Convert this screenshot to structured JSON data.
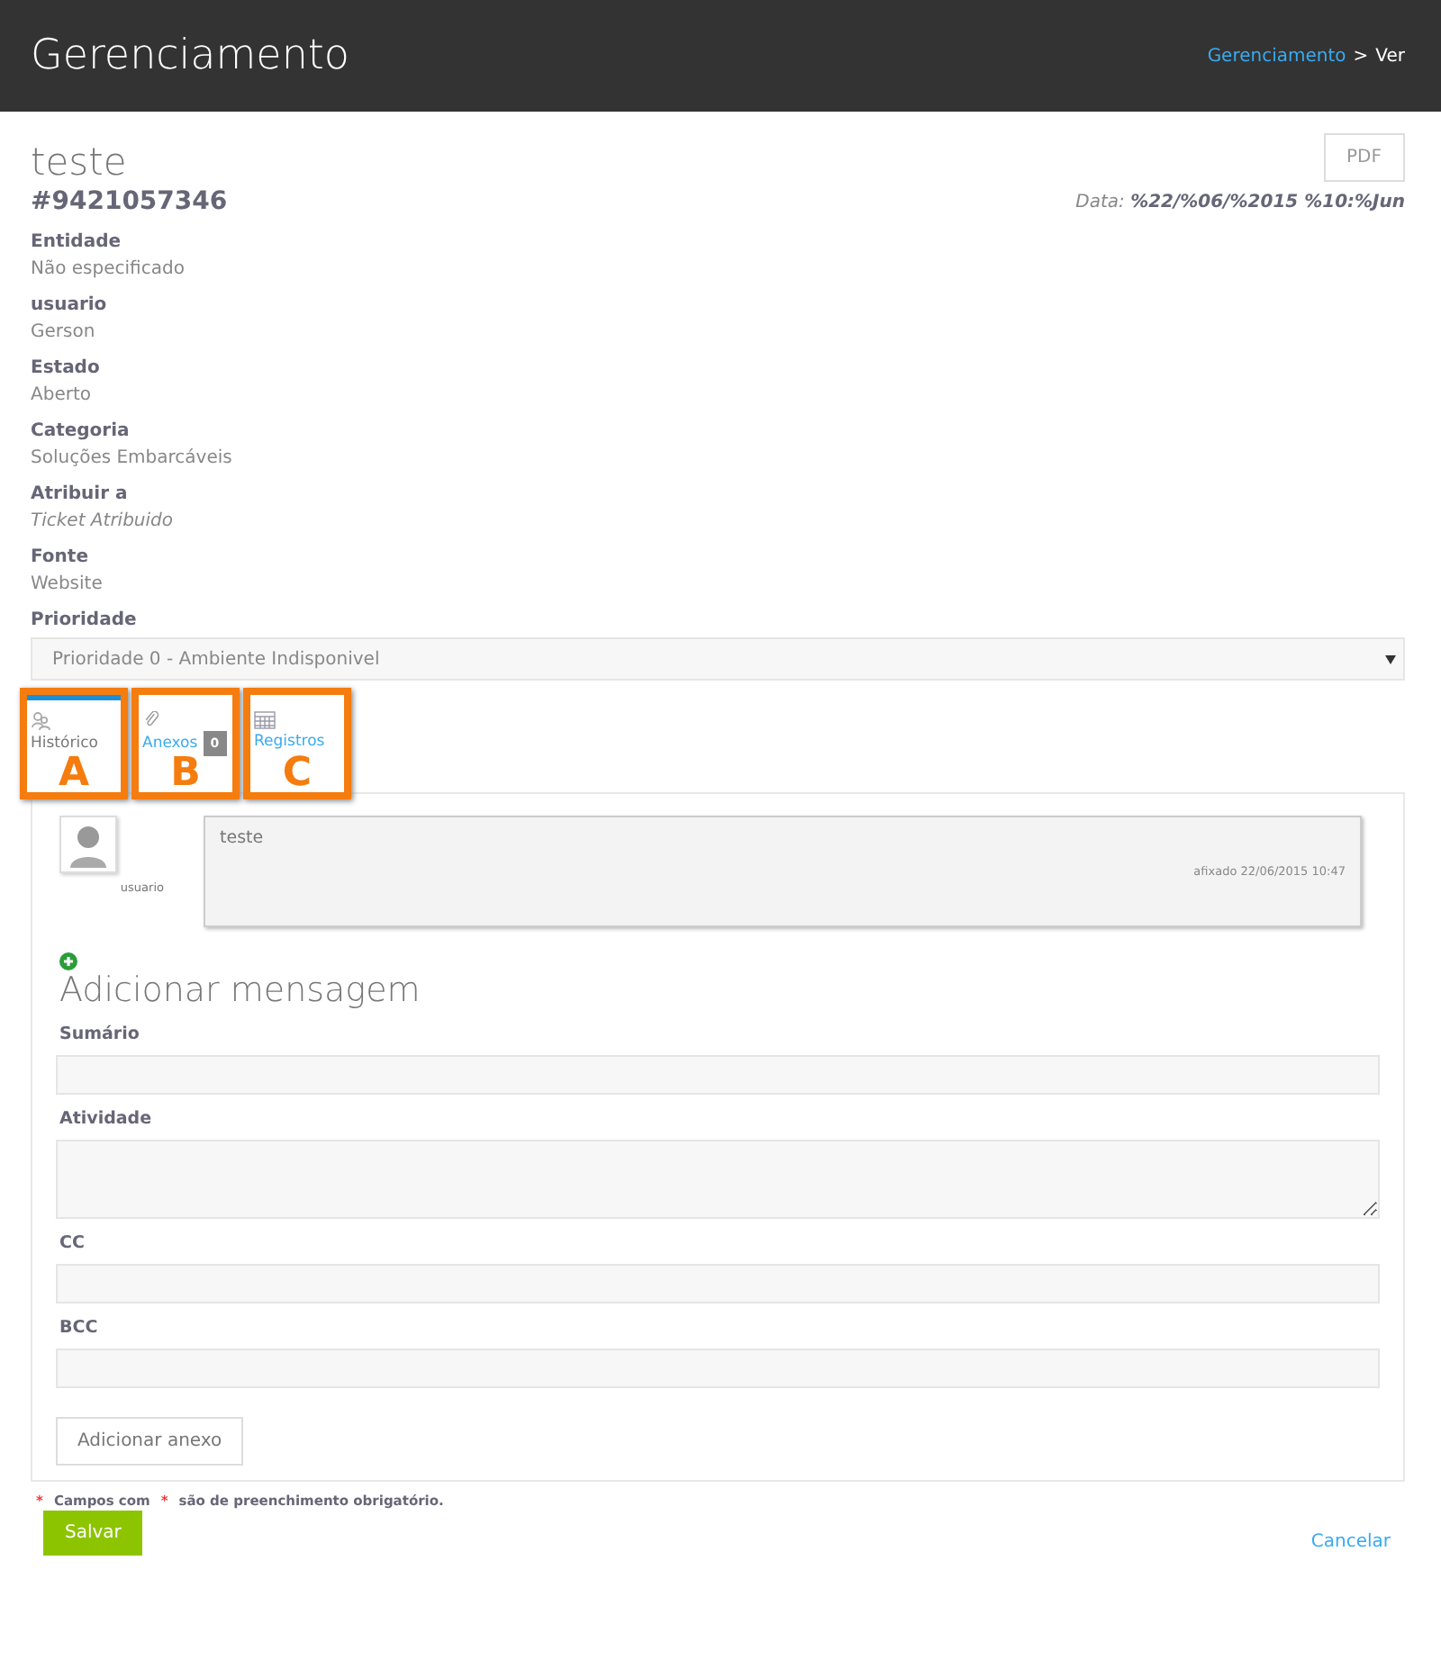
{
  "header": {
    "title": "Gerenciamento",
    "breadcrumb": [
      {
        "label": "Gerenciamento",
        "kind": "link"
      },
      {
        "label": "Ver",
        "kind": "current"
      }
    ],
    "separator": ">"
  },
  "ticket": {
    "title": "teste",
    "number": "#9421057346",
    "pdf_button": "PDF",
    "date": "Data: **%22/%06/%2015 %10:%Jun**"
  },
  "fields": [
    {
      "label": "Entidade",
      "value": "Não especificado",
      "italic": false
    },
    {
      "label": "usuario",
      "value": "Gerson",
      "italic": false
    },
    {
      "label": "Estado",
      "value": "Aberto",
      "italic": false
    },
    {
      "label": "Categoria",
      "value": "Soluções Embarcáveis",
      "italic": false
    },
    {
      "label": "Atribuir a",
      "value": "Ticket Atribuido",
      "italic": true
    },
    {
      "label": "Fonte",
      "value": "Website",
      "italic": false
    }
  ],
  "priority": {
    "label": "Prioridade",
    "value": "Prioridade 0 - Ambiente Indisponivel"
  },
  "tabs": [
    {
      "label": "Histórico",
      "kind": "history",
      "selected": true,
      "callout": "A"
    },
    {
      "label": "Anexos",
      "kind": "attachments",
      "selected": false,
      "badge": "0",
      "callout": "B"
    },
    {
      "label": "Registros",
      "kind": "logs",
      "selected": false,
      "callout": "C"
    }
  ],
  "messages": [
    {
      "user": "usuario",
      "text": "teste",
      "timestamp": "afixado 22/06/2015 10:47"
    }
  ],
  "form": {
    "title": "Adicionar mensagem",
    "fields": [
      {
        "label": "Sumário",
        "kind": "input"
      },
      {
        "label": "Atividade",
        "kind": "textarea"
      },
      {
        "label": "CC",
        "kind": "input"
      },
      {
        "label": "BCC",
        "kind": "input"
      }
    ],
    "attach_button": "Adicionar anexo"
  },
  "required_note": {
    "mark": "*",
    "before": "Campos com",
    "after": "são de preenchimento obrigatório."
  },
  "save_button": "Salvar",
  "cancel_link": "Cancelar"
}
